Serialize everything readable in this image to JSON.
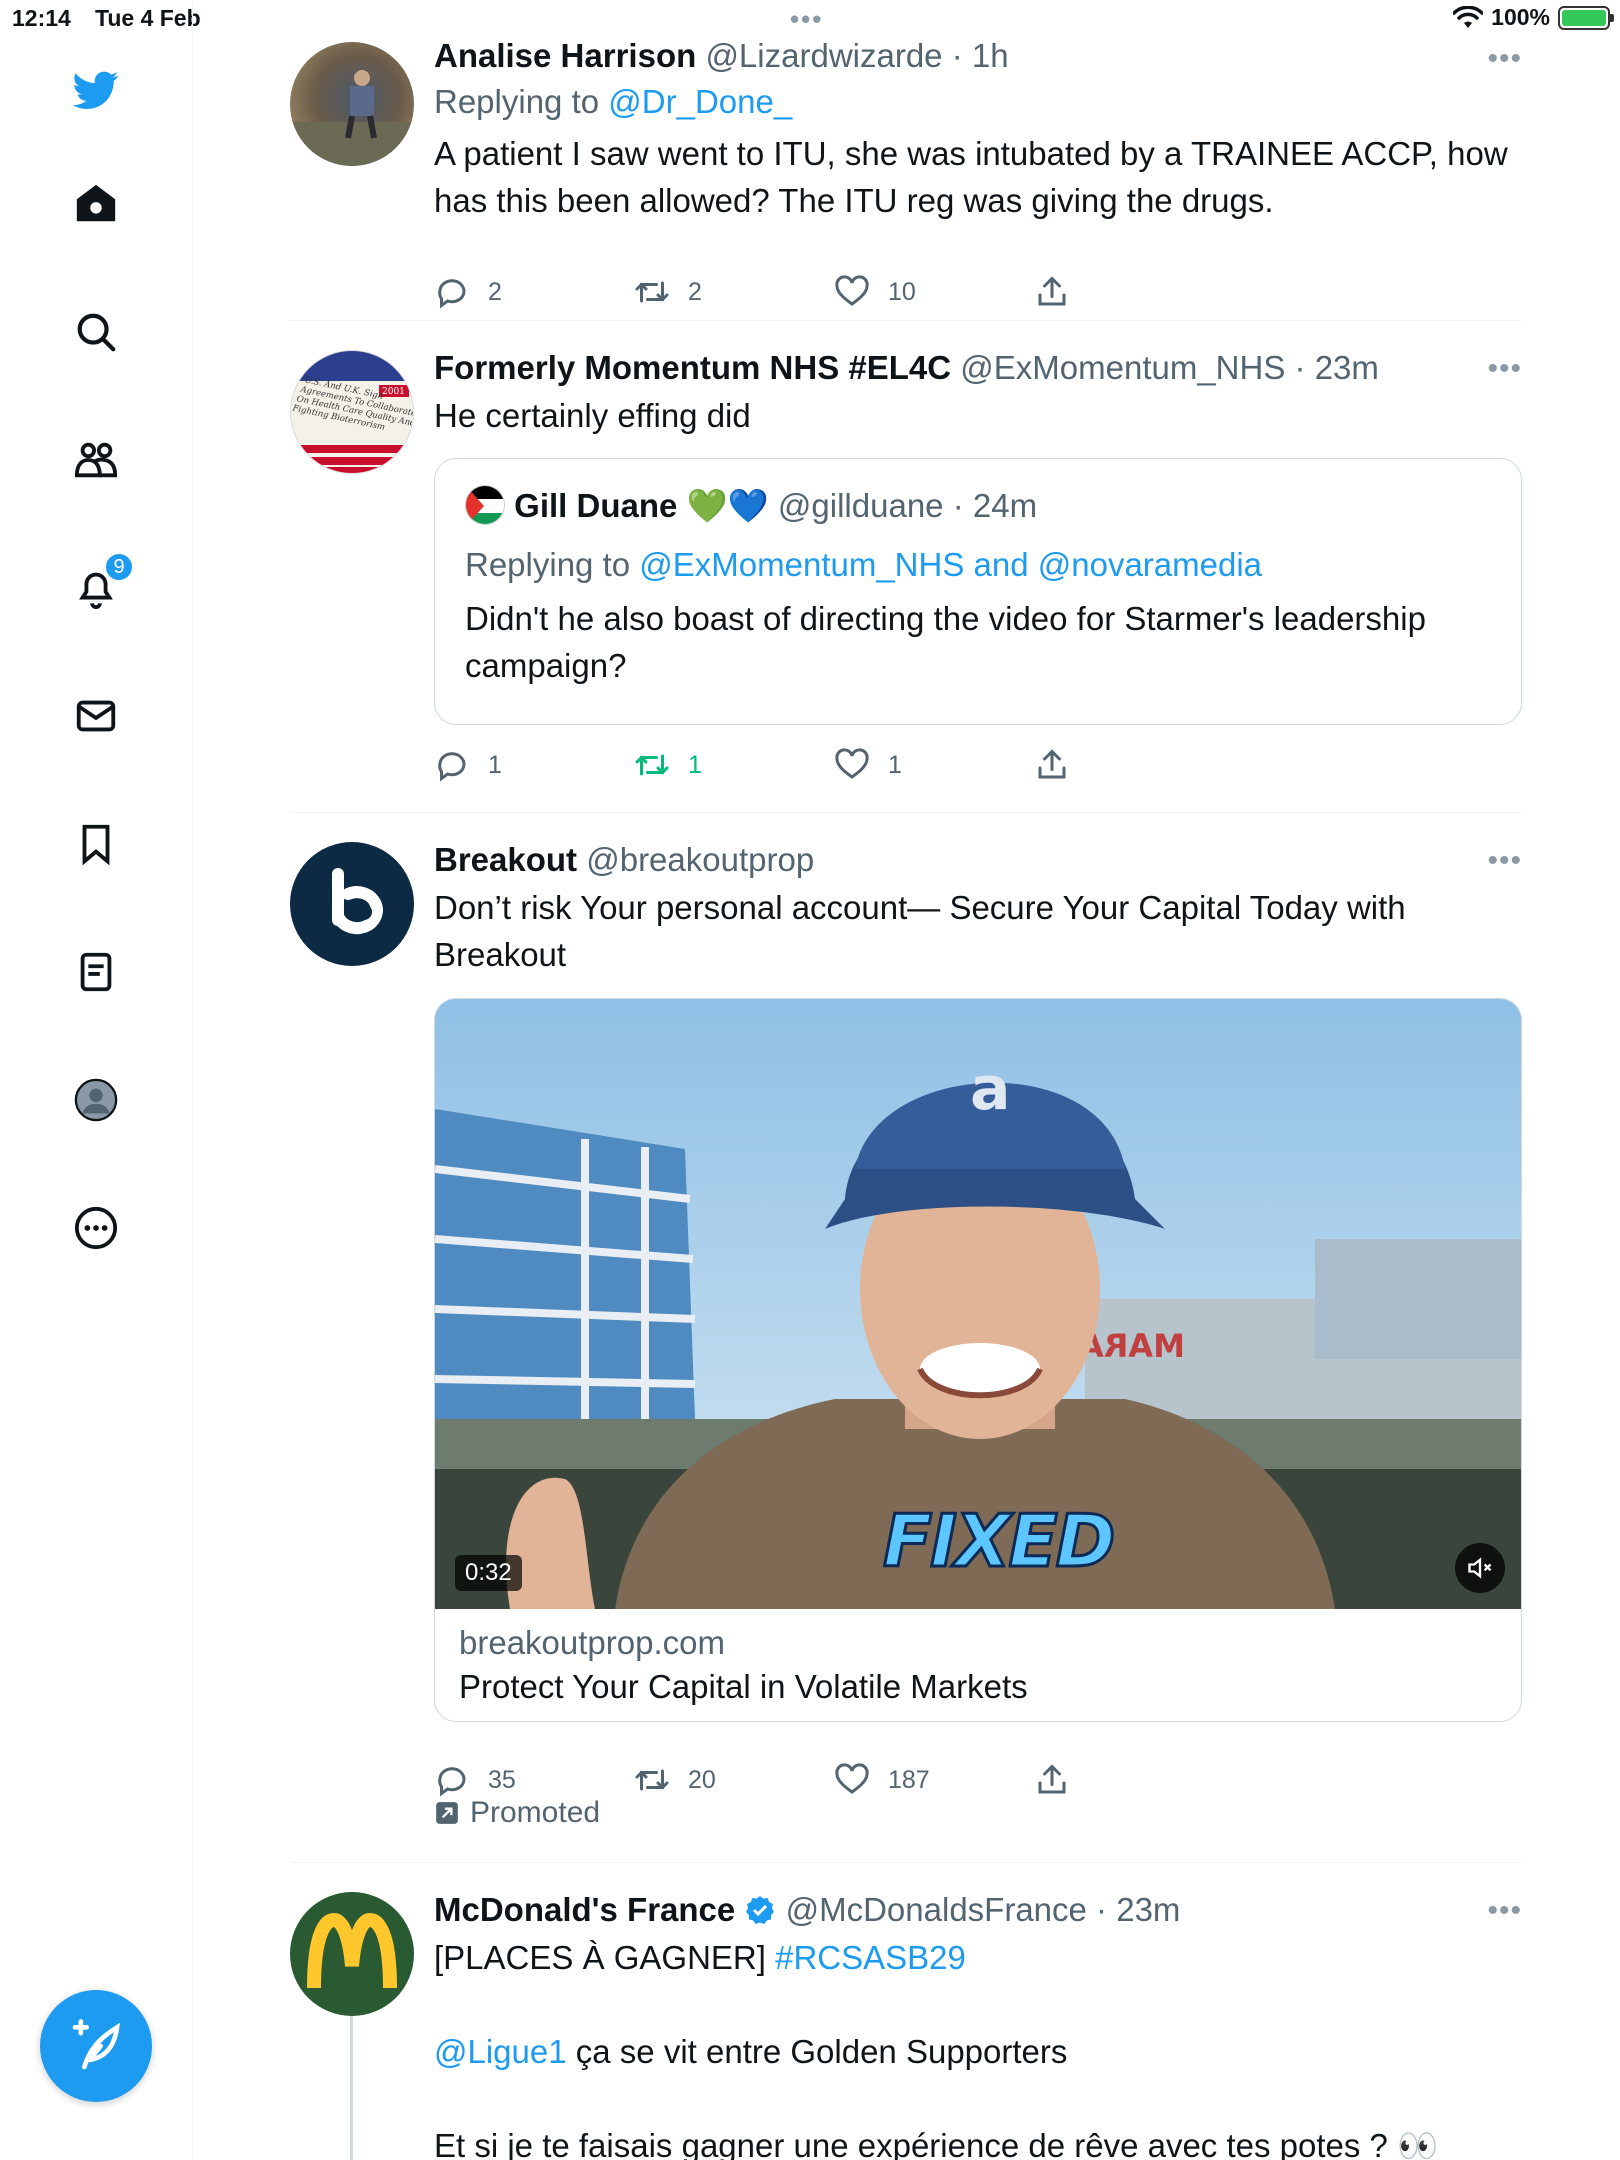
{
  "status_bar": {
    "time": "12:14",
    "date": "Tue 4 Feb",
    "dots": "•••",
    "battery": "100%"
  },
  "sidebar": {
    "notifications_badge": "9"
  },
  "tweets": [
    {
      "name": "Analise Harrison",
      "handle": "@Lizardwizarde",
      "time": "1h",
      "replying_prefix": "Replying to ",
      "replying_to": "@Dr_Done_",
      "text": "A patient I saw went to ITU, she was intubated by a TRAINEE ACCP, how has this been allowed? The ITU reg was giving the drugs.",
      "replies": "2",
      "retweets": "2",
      "likes": "10"
    },
    {
      "name": "Formerly Momentum NHS #EL4C",
      "handle": "@ExMomentum_NHS",
      "time": "23m",
      "text": "He certainly effing did",
      "avatar_text": "U.S. And U.K. Sign Agreements To Collaborate On Health Care Quality And Fighting Bioterrorism",
      "avatar_year": "2001",
      "quote": {
        "name": "Gill Duane",
        "emoji": "💚💙",
        "handle": "@gillduane",
        "time": "24m",
        "replying_prefix": "Replying to ",
        "replying_to": "@ExMomentum_NHS and @novaramedia",
        "text": "Didn't he also boast of directing the video for Starmer's leadership campaign?"
      },
      "replies": "1",
      "retweets": "1",
      "likes": "1"
    },
    {
      "name": "Breakout",
      "handle": "@breakoutprop",
      "text": "Don’t risk Your personal account— Secure Your Capital Today with Breakout",
      "video_duration": "0:32",
      "video_caption": "FIXED",
      "video_sign": "MARA",
      "card_domain": "breakoutprop.com",
      "card_title": "Protect Your Capital in Volatile Markets",
      "replies": "35",
      "retweets": "20",
      "likes": "187",
      "promoted": "Promoted"
    },
    {
      "name": "McDonald's France",
      "handle": "@McDonaldsFrance",
      "time": "23m",
      "line1_prefix": "[PLACES À GAGNER] ",
      "line1_hashtag": "#RCSASB29",
      "line2_mention": "@Ligue1",
      "line2_text": " ça se vit entre Golden Supporters",
      "line3": "Et si je te faisais gagner une expérience de rêve avec tes potes ? 👀"
    }
  ],
  "colors": {
    "accent": "#1d9bf0",
    "retweet_active": "#00ba7c",
    "text": "#0f1419",
    "secondary": "#536471"
  }
}
